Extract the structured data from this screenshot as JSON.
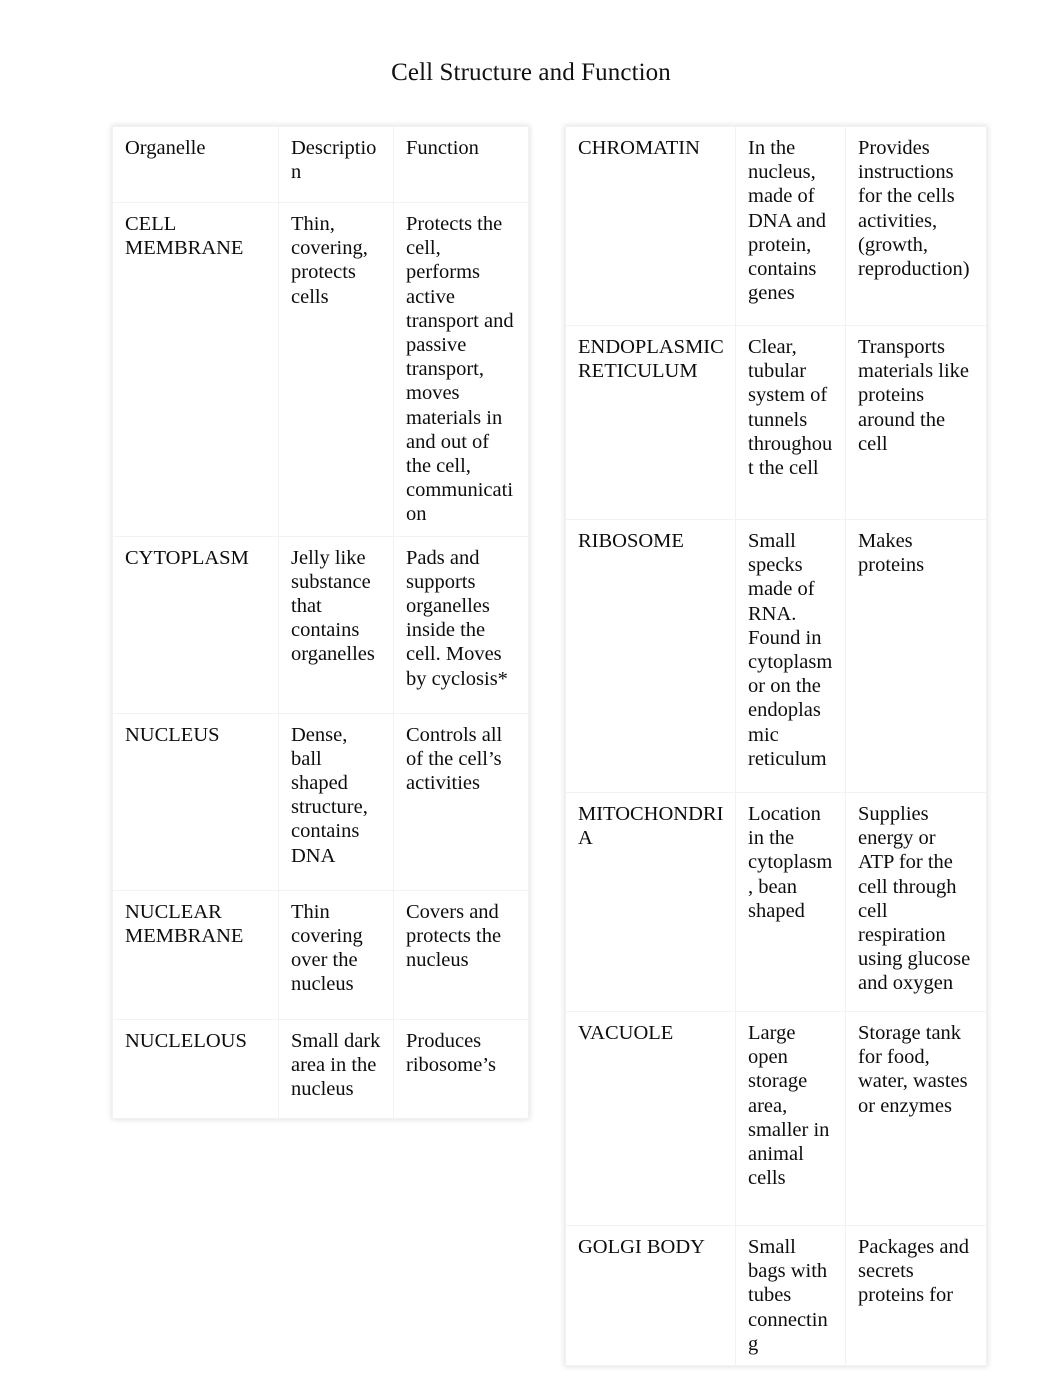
{
  "document": {
    "title": "Cell Structure and Function"
  },
  "tables": {
    "left": {
      "columns": [
        "Organelle",
        "Description",
        "Function"
      ],
      "rows": [
        {
          "organelle": "CELL MEMBRANE",
          "description": "Thin, covering, protects cells",
          "function": "Protects the cell, performs active transport and passive transport, moves materials in and out of the cell, communication"
        },
        {
          "organelle": "CYTOPLASM",
          "description": "Jelly like substance that contains organelles",
          "function": "Pads and supports organelles inside the cell. Moves by cyclosis*"
        },
        {
          "organelle": "NUCLEUS",
          "description": "Dense, ball shaped structure, contains DNA",
          "function": "Controls all of the cell’s activities"
        },
        {
          "organelle": "NUCLEAR MEMBRANE",
          "description": "Thin covering over the nucleus",
          "function": "Covers and protects the nucleus"
        },
        {
          "organelle": "NUCLELOUS",
          "description": "Small dark area in the nucleus",
          "function": "Produces ribosome’s"
        }
      ]
    },
    "right": {
      "rows": [
        {
          "organelle": "CHROMATIN",
          "description": "In the nucleus, made of DNA and protein, contains genes",
          "function": "Provides instructions for the cells activities, (growth, reproduction)"
        },
        {
          "organelle": "ENDOPLASMIC RETICULUM",
          "description": "Clear, tubular system of tunnels throughout the cell",
          "function": "Transports materials like proteins around the cell"
        },
        {
          "organelle": "RIBOSOME",
          "description": "Small specks made of RNA. Found in cytoplasm or on the endoplasmic reticulum",
          "function": "Makes proteins"
        },
        {
          "organelle": "MITOCHONDRIA",
          "description": "Location in the cytoplasm, bean shaped",
          "function": "Supplies energy or ATP for the cell through cell respiration using glucose and oxygen"
        },
        {
          "organelle": "VACUOLE",
          "description": "Large open storage area, smaller in animal cells",
          "function": "Storage tank for food, water, wastes or enzymes"
        },
        {
          "organelle": "GOLGI BODY",
          "description": "Small bags with tubes connecting",
          "function": "Packages and secrets proteins for"
        }
      ]
    }
  },
  "colors": {
    "page_background": "#ffffff",
    "text": "#0d0d0d",
    "gridline": "#f2f2f2"
  }
}
